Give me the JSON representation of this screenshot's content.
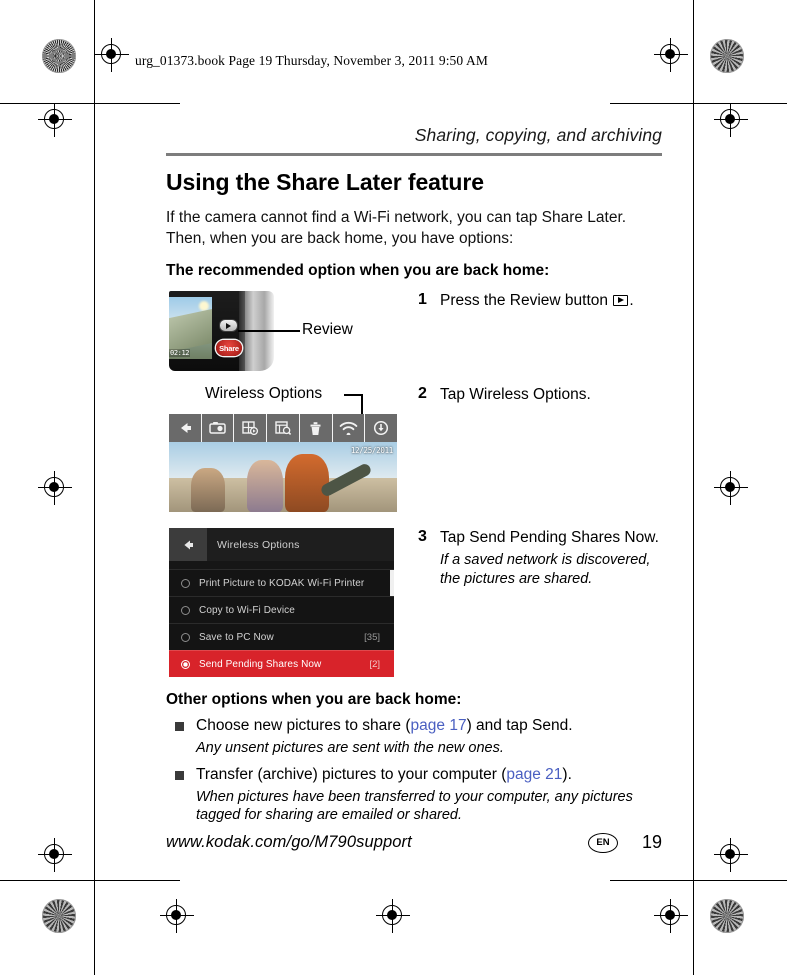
{
  "print_info": {
    "text": "urg_01373.book  Page 19  Thursday, November 3, 2011  9:50 AM"
  },
  "header": {
    "running_head": "Sharing, copying, and archiving",
    "title": "Using the Share Later feature"
  },
  "intro": {
    "paragraph": "If the camera cannot find a Wi-Fi network, you can tap Share Later. Then, when you are back home, you have options:",
    "lead": "The recommended option when you are back home:"
  },
  "steps": [
    {
      "number": "1",
      "text_before": "Press the Review button",
      "text_after": ".",
      "icon": "review-play-icon",
      "note": "",
      "figure": {
        "type": "camera-back",
        "callout_label": "Review",
        "lcd_time": "02:12",
        "share_button_label": "Share"
      }
    },
    {
      "number": "2",
      "text_before": "Tap Wireless Options.",
      "text_after": "",
      "icon": "",
      "note": "",
      "figure": {
        "type": "review-screen",
        "callout_label": "Wireless Options",
        "photo_date": "12/25/2011",
        "toolbar_icons": [
          "back-arrow-icon",
          "camera-icon",
          "slideshow-icon",
          "find-pictures-icon",
          "trash-icon",
          "wifi-icon",
          "download-icon"
        ]
      }
    },
    {
      "number": "3",
      "text_before": "Tap Send Pending Shares Now.",
      "text_after": "",
      "icon": "",
      "note": "If a saved network is discovered, the pictures are shared.",
      "figure": {
        "type": "wireless-options-menu",
        "menu_title": "Wireless Options",
        "items": [
          {
            "label": "Print Picture to KODAK Wi-Fi Printer",
            "count": "",
            "selected": false
          },
          {
            "label": "Copy to Wi-Fi Device",
            "count": "",
            "selected": false
          },
          {
            "label": "Save to PC Now",
            "count": "[35]",
            "selected": false
          },
          {
            "label": "Send Pending Shares Now",
            "count": "[2]",
            "selected": true
          }
        ]
      }
    }
  ],
  "other_options": {
    "heading": "Other options when you are back home:",
    "bullets": [
      {
        "text_before": "Choose new pictures to share (",
        "link": "page 17",
        "text_after": ") and tap Send.",
        "note": "Any unsent pictures are sent with the new ones."
      },
      {
        "text_before": "Transfer (archive) pictures to your computer (",
        "link": "page 21",
        "text_after": ").",
        "note": "When pictures have been transferred to your computer, any pictures tagged for sharing are emailed or shared."
      }
    ]
  },
  "footer": {
    "url": "www.kodak.com/go/M790support",
    "language": "EN",
    "page_number": "19"
  },
  "colors": {
    "rule": "#7d7d7d",
    "link": "#4a5fc1",
    "selected_row": "#d8232a",
    "menu_background": "#141414",
    "toolbar": "#6a6a6a"
  }
}
